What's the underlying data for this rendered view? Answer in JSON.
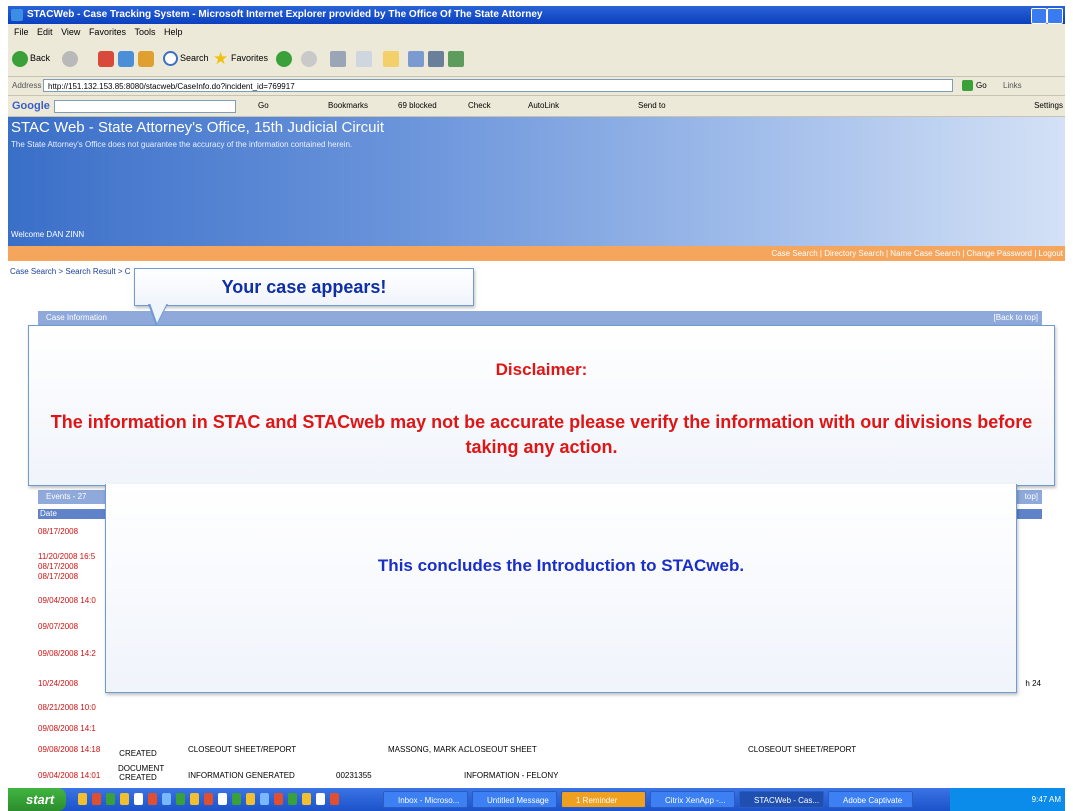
{
  "window": {
    "title": "STACWeb - Case Tracking System - Microsoft Internet Explorer provided by The Office Of The State Attorney"
  },
  "menu": [
    "File",
    "Edit",
    "View",
    "Favorites",
    "Tools",
    "Help"
  ],
  "toolbar": {
    "back": "Back",
    "search": "Search",
    "favorites": "Favorites"
  },
  "address": {
    "label": "Address",
    "url": "http://151.132.153.85:8080/stacweb/CaseInfo.do?incident_id=769917",
    "go": "Go",
    "links": "Links"
  },
  "googlebar": {
    "logo": "Google",
    "go": "Go",
    "bookmarks": "Bookmarks",
    "blocked": "69 blocked",
    "check": "Check",
    "autolink": "AutoLink",
    "sendto": "Send to",
    "settings": "Settings"
  },
  "page": {
    "title": "STAC Web - State Attorney's Office, 15th Judicial Circuit",
    "subtitle": "The State Attorney's Office does not guarantee the accuracy of the information contained herein.",
    "welcome": "Welcome DAN ZINN",
    "nav_links": "Case Search | Directory Search | Name Case Search | Change Password | Logout",
    "breadcrumb": "Case Search > Search Result > C",
    "case_info_section": "Case Information",
    "back_to_top": "[Back to top]",
    "events_section": "Events - 27",
    "events_back": "top]",
    "date_header": "Date",
    "stray_text": "h 24"
  },
  "events": [
    {
      "date": "08/17/2008"
    },
    {
      "date": "11/20/2008 16:5"
    },
    {
      "date": "08/17/2008"
    },
    {
      "date": "08/17/2008"
    },
    {
      "date": "09/04/2008 14:0"
    },
    {
      "date": "09/07/2008"
    },
    {
      "date": "09/08/2008 14:2"
    },
    {
      "date": "10/24/2008"
    },
    {
      "date": "08/21/2008 10:0"
    },
    {
      "date": "09/08/2008 14:1"
    },
    {
      "date": "09/08/2008 14:18",
      "type": "CREATED",
      "description": "CLOSEOUT SHEET/REPORT",
      "person": "MASSONG, MARK A.",
      "document": "CLOSEOUT SHEET",
      "document2": "CLOSEOUT SHEET/REPORT"
    },
    {
      "date": "09/04/2008 14:01",
      "type": "DOCUMENT CREATED",
      "description": "INFORMATION GENERATED",
      "number": "00231355",
      "document": "INFORMATION - FELONY"
    }
  ],
  "callouts": {
    "case_appears": "Your case appears!",
    "disclaimer_title": "Disclaimer:",
    "disclaimer_body": "The information in STAC and STACweb may not be accurate please verify the information with our divisions before taking any action.",
    "conclusion": "This concludes the Introduction to STACweb."
  },
  "taskbar": {
    "start": "start",
    "items": [
      "Inbox - Microso...",
      "Untitled Message",
      "1 Reminder",
      "Citrix XenApp -...",
      "STACWeb - Cas...",
      "Adobe Captivate"
    ],
    "clock": "9:47 AM"
  }
}
